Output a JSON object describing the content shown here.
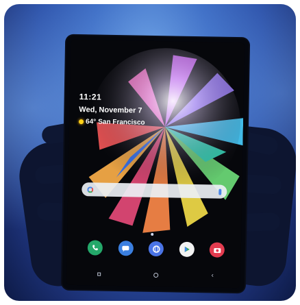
{
  "lockscreen": {
    "time": "11:21",
    "date": "Wed, November 7",
    "weather": {
      "temperature": "64°",
      "location": "San Francisco",
      "icon": "sun-icon"
    }
  },
  "search": {
    "placeholder": ""
  },
  "dock": {
    "apps": [
      {
        "name": "phone",
        "icon": "phone-icon"
      },
      {
        "name": "messages",
        "icon": "messages-icon"
      },
      {
        "name": "internet",
        "icon": "internet-icon"
      },
      {
        "name": "play-store",
        "icon": "play-store-icon"
      },
      {
        "name": "camera",
        "icon": "camera-icon"
      }
    ]
  },
  "navigation": {
    "recents": "recents-icon",
    "home": "home-icon",
    "back": "back-icon"
  },
  "colors": {
    "background": "#2a4fa8",
    "phone_frame": "#05070d",
    "sun": "#ffd21a",
    "search_bar": "#ebf0f5"
  }
}
